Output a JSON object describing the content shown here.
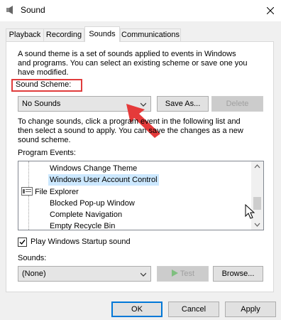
{
  "window": {
    "title": "Sound",
    "close_glyph": "✕"
  },
  "tabs": [
    {
      "label": "Playback"
    },
    {
      "label": "Recording"
    },
    {
      "label": "Sounds"
    },
    {
      "label": "Communications"
    }
  ],
  "sounds": {
    "intro_lines": [
      "A sound theme is a set of sounds applied to events in Windows",
      "and programs.  You can select an existing scheme or save one you",
      "have modified."
    ],
    "scheme_label": "Sound Scheme:",
    "scheme_value": "No Sounds",
    "save_as": "Save As...",
    "delete": "Delete",
    "instructions_lines": [
      "To change sounds, click a program event in the following list and",
      "then select a sound to apply.  You can save the changes as a new",
      "sound scheme."
    ],
    "events_label": "Program Events:",
    "events": [
      {
        "label": "Windows Change Theme",
        "level": 2
      },
      {
        "label": "Windows User Account Control",
        "level": 2,
        "selected": true
      },
      {
        "label": "File Explorer",
        "level": 1
      },
      {
        "label": "Blocked Pop-up Window",
        "level": 2
      },
      {
        "label": "Complete Navigation",
        "level": 2
      },
      {
        "label": "Empty Recycle Bin",
        "level": 2
      }
    ],
    "startup_checkbox": {
      "label": "Play Windows Startup sound",
      "checked": true
    },
    "sounds_label": "Sounds:",
    "sounds_value": "(None)",
    "test": "Test",
    "browse": "Browse..."
  },
  "footer": {
    "ok": "OK",
    "cancel": "Cancel",
    "apply": "Apply"
  },
  "colors": {
    "highlight_border": "#e03c3c",
    "selection_bg": "#cce8ff",
    "arrow": "#e53a3a"
  },
  "icons": [
    "speaker-icon",
    "close-icon",
    "chevron-down-icon",
    "play-icon",
    "category-icon",
    "red-arrow-annotation",
    "mouse-cursor-icon"
  ]
}
